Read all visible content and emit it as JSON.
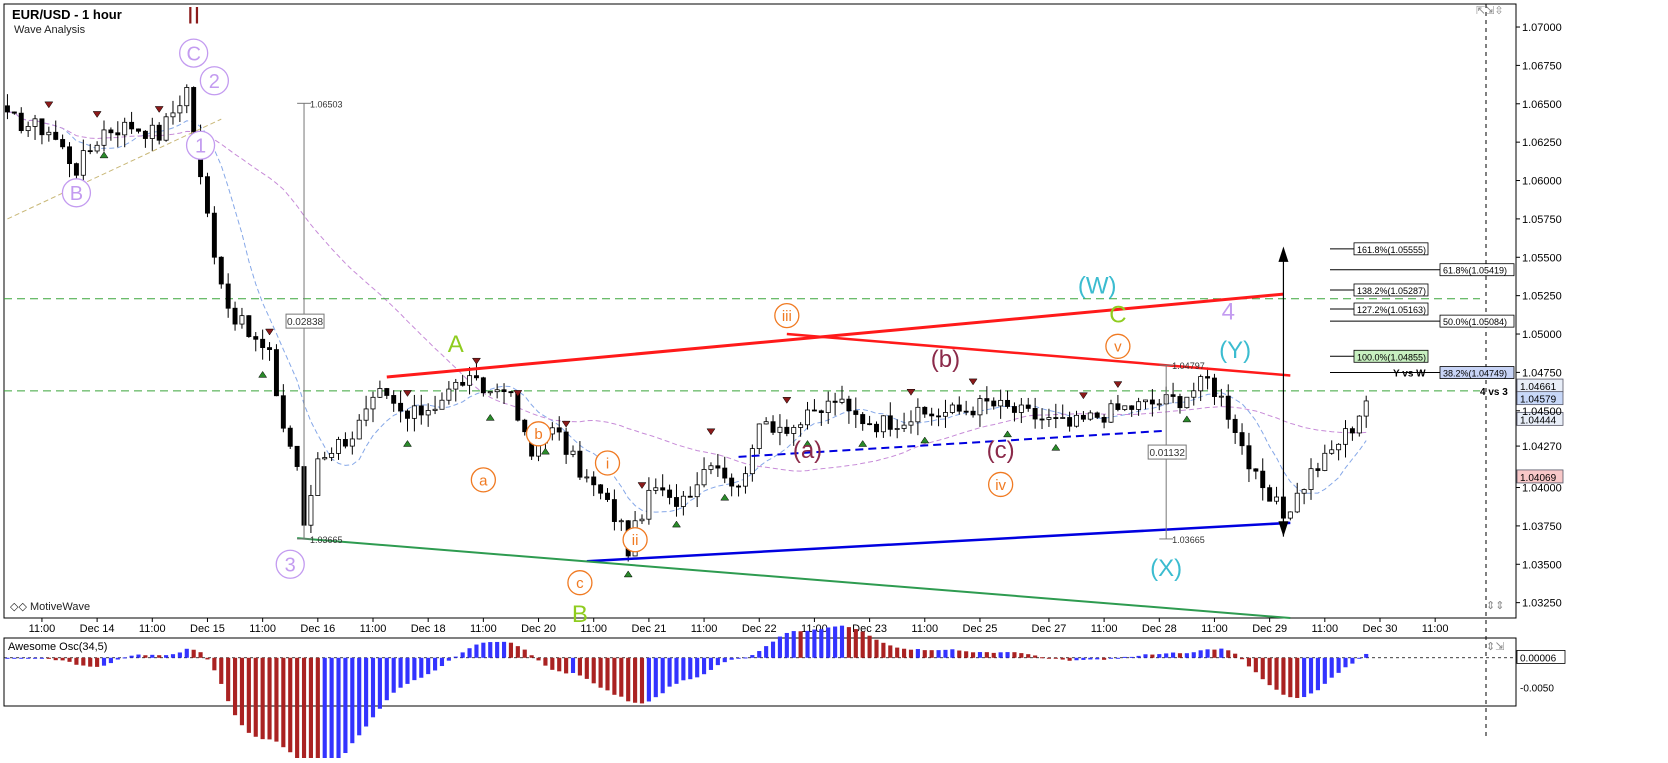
{
  "header": {
    "title": "EUR/USD - 1 hour",
    "subtitle": "Wave Analysis",
    "watermark": "◇◇ MotiveWave",
    "osc_label": "Awesome Osc(34,5)"
  },
  "colors": {
    "red_line": "#ff1a1a",
    "blue_line": "#0000e0",
    "green_line": "#2e9b50",
    "green_dash": "#3aa53a",
    "purple_wave": "#c39bf0",
    "orange_wave": "#f07a22",
    "maroon_wave": "#8b2a4a",
    "cyan_wave": "#3bbcd0",
    "lime_wave": "#8fcc1f",
    "dark_red_wave": "#8b1a1a",
    "osc_up": "#3333ff",
    "osc_down": "#aa2222"
  },
  "chart_data": {
    "type": "candlestick",
    "title": "EUR/USD - 1 hour",
    "subtitle": "Wave Analysis",
    "ylim": [
      1.0315,
      1.0715
    ],
    "y_ticks": [
      "1.07000",
      "1.06750",
      "1.06500",
      "1.06250",
      "1.06000",
      "1.05750",
      "1.05500",
      "1.05250",
      "1.05000",
      "1.04750",
      "1.04500",
      "1.04270",
      "1.04000",
      "1.03750",
      "1.03500",
      "1.03250"
    ],
    "y_tick_values": [
      1.07,
      1.0675,
      1.065,
      1.0625,
      1.06,
      1.0575,
      1.055,
      1.0525,
      1.05,
      1.0475,
      1.045,
      1.0427,
      1.04,
      1.0375,
      1.035,
      1.0325
    ],
    "x_ticks": [
      "11:00",
      "Dec 14",
      "11:00",
      "Dec 15",
      "11:00",
      "Dec 16",
      "11:00",
      "Dec 18",
      "11:00",
      "Dec 20",
      "11:00",
      "Dec 21",
      "11:00",
      "Dec 22",
      "11:00",
      "Dec 23",
      "11:00",
      "Dec 25",
      "Dec 27",
      "11:00",
      "Dec 28",
      "11:00",
      "Dec 29",
      "11:00",
      "Dec 30",
      "11:00"
    ],
    "x_tick_index": [
      5,
      13,
      21,
      29,
      37,
      45,
      53,
      61,
      69,
      77,
      85,
      93,
      101,
      109,
      117,
      125,
      133,
      141,
      151,
      159,
      167,
      175,
      183,
      191,
      199,
      207
    ],
    "price_path": [
      [
        0,
        1.064
      ],
      [
        6,
        1.0633
      ],
      [
        10,
        1.0608
      ],
      [
        14,
        1.0633
      ],
      [
        18,
        1.0636
      ],
      [
        22,
        1.063
      ],
      [
        26,
        1.066
      ],
      [
        28,
        1.06
      ],
      [
        30,
        1.0555
      ],
      [
        32,
        1.0518
      ],
      [
        35,
        1.05
      ],
      [
        38,
        1.0485
      ],
      [
        40,
        1.044
      ],
      [
        42,
        1.0415
      ],
      [
        43,
        1.0372
      ],
      [
        45,
        1.042
      ],
      [
        50,
        1.0435
      ],
      [
        54,
        1.046
      ],
      [
        58,
        1.0445
      ],
      [
        62,
        1.0455
      ],
      [
        66,
        1.047
      ],
      [
        70,
        1.0462
      ],
      [
        72,
        1.0468
      ],
      [
        74,
        1.0445
      ],
      [
        76,
        1.042
      ],
      [
        78,
        1.044
      ],
      [
        80,
        1.0432
      ],
      [
        82,
        1.0418
      ],
      [
        84,
        1.0405
      ],
      [
        86,
        1.0395
      ],
      [
        89,
        1.0375
      ],
      [
        90,
        1.036
      ],
      [
        92,
        1.0385
      ],
      [
        94,
        1.04
      ],
      [
        96,
        1.039
      ],
      [
        98,
        1.0395
      ],
      [
        100,
        1.0405
      ],
      [
        102,
        1.042
      ],
      [
        104,
        1.041
      ],
      [
        106,
        1.0398
      ],
      [
        108,
        1.043
      ],
      [
        110,
        1.0442
      ],
      [
        114,
        1.044
      ],
      [
        118,
        1.045
      ],
      [
        120,
        1.0458
      ],
      [
        122,
        1.0448
      ],
      [
        124,
        1.0445
      ],
      [
        126,
        1.0442
      ],
      [
        130,
        1.0445
      ],
      [
        134,
        1.0448
      ],
      [
        138,
        1.045
      ],
      [
        142,
        1.0455
      ],
      [
        146,
        1.045
      ],
      [
        150,
        1.0445
      ],
      [
        154,
        1.044
      ],
      [
        158,
        1.0447
      ],
      [
        162,
        1.0452
      ],
      [
        166,
        1.0455
      ],
      [
        170,
        1.0458
      ],
      [
        174,
        1.047
      ],
      [
        176,
        1.0458
      ],
      [
        178,
        1.044
      ],
      [
        180,
        1.0415
      ],
      [
        182,
        1.0395
      ],
      [
        184,
        1.0388
      ],
      [
        185,
        1.0382
      ],
      [
        187,
        1.0395
      ],
      [
        189,
        1.041
      ],
      [
        191,
        1.0418
      ],
      [
        193,
        1.043
      ],
      [
        195,
        1.044
      ],
      [
        197,
        1.0458
      ]
    ],
    "last_index": 197,
    "overlay_labels": {
      "fib_right": [
        "161.8%(1.05555)",
        "61.8%(1.05419)",
        "138.2%(1.05287)",
        "127.2%(1.05163)",
        "50.0%(1.05084)",
        "100.0%(1.04855)",
        "38.2%(1.04749)"
      ],
      "fib_values": [
        1.05555,
        1.05419,
        1.05287,
        1.05163,
        1.05084,
        1.04855,
        1.04749
      ],
      "price_tags": [
        "1.04661",
        "1.04579",
        "1.04444",
        "1.04069"
      ],
      "price_tag_values": [
        1.04661,
        1.04579,
        1.04444,
        1.04069
      ],
      "measure_left": {
        "top": "1.06503",
        "diff": "0.02838",
        "bottom": "1.03665"
      },
      "measure_right": {
        "top": "1.04797",
        "diff": "0.01132",
        "bottom": "1.03665"
      },
      "text_notes": [
        "Y vs W",
        "4 vs 3"
      ]
    },
    "wave_labels": [
      {
        "text": "II",
        "style": "dark_red_wave",
        "i": 27,
        "p": 1.0708
      },
      {
        "text": "C",
        "style": "purple_wave",
        "i": 27,
        "p": 1.0683,
        "circle": true
      },
      {
        "text": "2",
        "style": "purple_wave",
        "i": 30,
        "p": 1.0665,
        "circle": true
      },
      {
        "text": "1",
        "style": "purple_wave",
        "i": 28,
        "p": 1.0623,
        "circle": true
      },
      {
        "text": "B",
        "style": "purple_wave",
        "i": 10,
        "p": 1.0592,
        "circle": true
      },
      {
        "text": "3",
        "style": "purple_wave",
        "i": 41,
        "p": 1.035,
        "circle": true
      },
      {
        "text": "A",
        "style": "lime_wave",
        "i": 65,
        "p": 1.0494
      },
      {
        "text": "a",
        "style": "orange_wave",
        "i": 69,
        "p": 1.0405,
        "circle": true
      },
      {
        "text": "b",
        "style": "orange_wave",
        "i": 77,
        "p": 1.0435,
        "circle": true
      },
      {
        "text": "c",
        "style": "orange_wave",
        "i": 83,
        "p": 1.0338,
        "circle": true
      },
      {
        "text": "B",
        "style": "lime_wave",
        "i": 83,
        "p": 1.0318
      },
      {
        "text": "i",
        "style": "orange_wave",
        "i": 87,
        "p": 1.0416,
        "circle": true
      },
      {
        "text": "ii",
        "style": "orange_wave",
        "i": 91,
        "p": 1.0366,
        "circle": true
      },
      {
        "text": "iii",
        "style": "orange_wave",
        "i": 113,
        "p": 1.0512,
        "circle": true
      },
      {
        "text": "(a)",
        "style": "maroon_wave",
        "i": 116,
        "p": 1.0425
      },
      {
        "text": "(b)",
        "style": "maroon_wave",
        "i": 136,
        "p": 1.0484
      },
      {
        "text": "(c)",
        "style": "maroon_wave",
        "i": 144,
        "p": 1.0425
      },
      {
        "text": "iv",
        "style": "orange_wave",
        "i": 144,
        "p": 1.0402,
        "circle": true
      },
      {
        "text": "v",
        "style": "orange_wave",
        "i": 161,
        "p": 1.0492,
        "circle": true
      },
      {
        "text": "C",
        "style": "lime_wave",
        "i": 161,
        "p": 1.0513
      },
      {
        "text": "(W)",
        "style": "cyan_wave",
        "i": 158,
        "p": 1.0532
      },
      {
        "text": "4",
        "style": "purple_wave",
        "i": 177,
        "p": 1.0515
      },
      {
        "text": "(Y)",
        "style": "cyan_wave",
        "i": 178,
        "p": 1.049
      },
      {
        "text": "(X)",
        "style": "cyan_wave",
        "i": 168,
        "p": 1.0348
      }
    ],
    "osc": {
      "y_ticks": [
        "0.00006",
        "-0.0050"
      ],
      "y_values": [
        6e-05,
        -0.005
      ],
      "ylim": [
        -0.0078,
        0.003
      ]
    }
  }
}
